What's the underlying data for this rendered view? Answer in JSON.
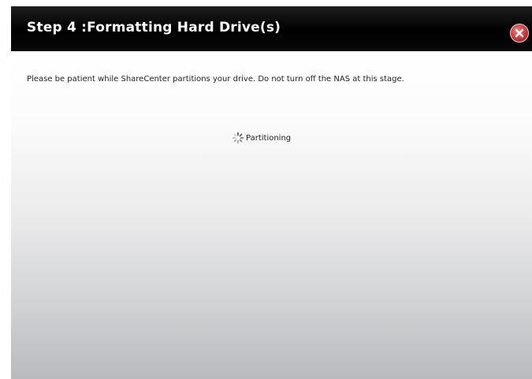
{
  "dialog": {
    "title": "Step 4 :Formatting Hard Drive(s)",
    "message": "Please be patient while ShareCenter partitions your drive. Do not turn off the NAS at this stage.",
    "status": {
      "icon": "spinner-icon",
      "text": "Partitioning"
    },
    "close_icon": "close-icon",
    "colors": {
      "titlebar": "#000000",
      "title_text": "#ffffff",
      "close_button": "#c93434"
    }
  }
}
